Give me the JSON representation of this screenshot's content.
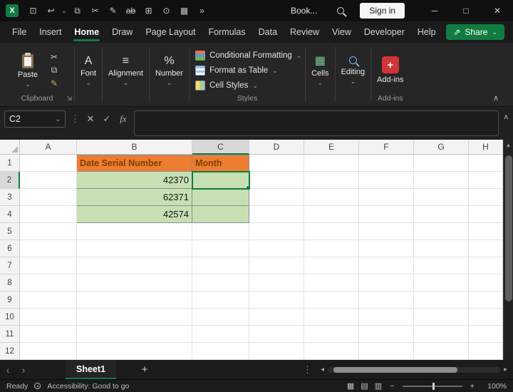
{
  "colors": {
    "accent_green": "#107C41",
    "header_orange": "#ED7D31",
    "header_orange_text": "#7F3E04",
    "cell_green": "#C6E0B4",
    "addins_red": "#D13438"
  },
  "icons": {
    "caret_down": "⌄",
    "chevron_up": "∧",
    "ellipsis_vertical": "⋮",
    "cancel": "✕",
    "enter": "✓",
    "launcher": "⇲",
    "share_arrow": "⇗",
    "chevron_left": "‹",
    "chevron_right": "›",
    "triangle_left": "◂",
    "triangle_right": "▸",
    "triangle_up": "▲",
    "addins_plus": "+"
  },
  "titlebar": {
    "app_logo_letter": "X",
    "quick_access": [
      {
        "name": "save-icon",
        "glyph": "⊡"
      },
      {
        "name": "undo-icon",
        "glyph": "↩"
      },
      {
        "name": "undo-menu-icon",
        "glyph": "⌄"
      },
      {
        "name": "copy-icon",
        "glyph": "⧉"
      },
      {
        "name": "cut-icon",
        "glyph": "✂"
      },
      {
        "name": "pen-icon",
        "glyph": "✎"
      },
      {
        "name": "strikethrough-icon",
        "glyph": "ab"
      },
      {
        "name": "borders-icon",
        "glyph": "⊞"
      },
      {
        "name": "camera-icon",
        "glyph": "⊙"
      },
      {
        "name": "table-icon",
        "glyph": "▦"
      },
      {
        "name": "overflow-icon",
        "glyph": "»"
      }
    ],
    "doc_title": "Book...",
    "signin_label": "Sign in",
    "window_controls": [
      {
        "name": "minimize-button",
        "glyph": "─"
      },
      {
        "name": "maximize-button",
        "glyph": "□"
      },
      {
        "name": "close-button",
        "glyph": "✕"
      }
    ]
  },
  "menubar": {
    "tabs": [
      "File",
      "Insert",
      "Home",
      "Draw",
      "Page Layout",
      "Formulas",
      "Data",
      "Review",
      "View",
      "Developer",
      "Help"
    ],
    "active_tab": "Home",
    "share_label": "Share"
  },
  "ribbon": {
    "paste_label": "Paste",
    "clipboard_icons": [
      {
        "name": "cut-icon",
        "glyph": "✂"
      },
      {
        "name": "copy-icon",
        "glyph": "⧉"
      },
      {
        "name": "format-painter-icon",
        "glyph": "✎"
      }
    ],
    "clipboard_group_label": "Clipboard",
    "font_label": "Font",
    "font_glyph": "A",
    "alignment_label": "Alignment",
    "alignment_glyph": "≡",
    "number_label": "Number",
    "number_glyph": "%",
    "styles_buttons": [
      "Conditional Formatting",
      "Format as Table",
      "Cell Styles"
    ],
    "styles_group_label": "Styles",
    "cells_label": "Cells",
    "cells_glyph": "▦",
    "editing_label": "Editing",
    "addins_label": "Add-ins",
    "addins_group_label": "Add-ins"
  },
  "formula_bar": {
    "name_box_value": "C2",
    "fx_label": "fx",
    "formula_value": ""
  },
  "grid": {
    "columns": [
      "A",
      "B",
      "C",
      "D",
      "E",
      "F",
      "G",
      "H"
    ],
    "row_count": 12,
    "cells": {
      "B1": "Date Serial Number",
      "C1": "Month",
      "B2": "42370",
      "B3": "62371",
      "B4": "42574"
    },
    "cell_styles": {
      "B1": "orange-header",
      "C1": "orange-header",
      "B2": "green-fill",
      "B3": "green-fill",
      "B4": "green-fill",
      "C2": "green-fill",
      "C3": "green-fill",
      "C4": "green-fill"
    },
    "active_cell": "C2",
    "selected_column": "C",
    "selected_row": 2
  },
  "sheet_bar": {
    "tabs": [
      "Sheet1"
    ],
    "active_tab": "Sheet1",
    "add_sheet_label": "+"
  },
  "status_bar": {
    "mode": "Ready",
    "accessibility": "Accessibility: Good to go",
    "view_icons": [
      {
        "name": "normal-view-icon",
        "glyph": "▦"
      },
      {
        "name": "page-layout-view-icon",
        "glyph": "▤"
      },
      {
        "name": "page-break-view-icon",
        "glyph": "▥"
      }
    ],
    "zoom_out": "−",
    "zoom_in": "+",
    "zoom_level": "100%"
  }
}
